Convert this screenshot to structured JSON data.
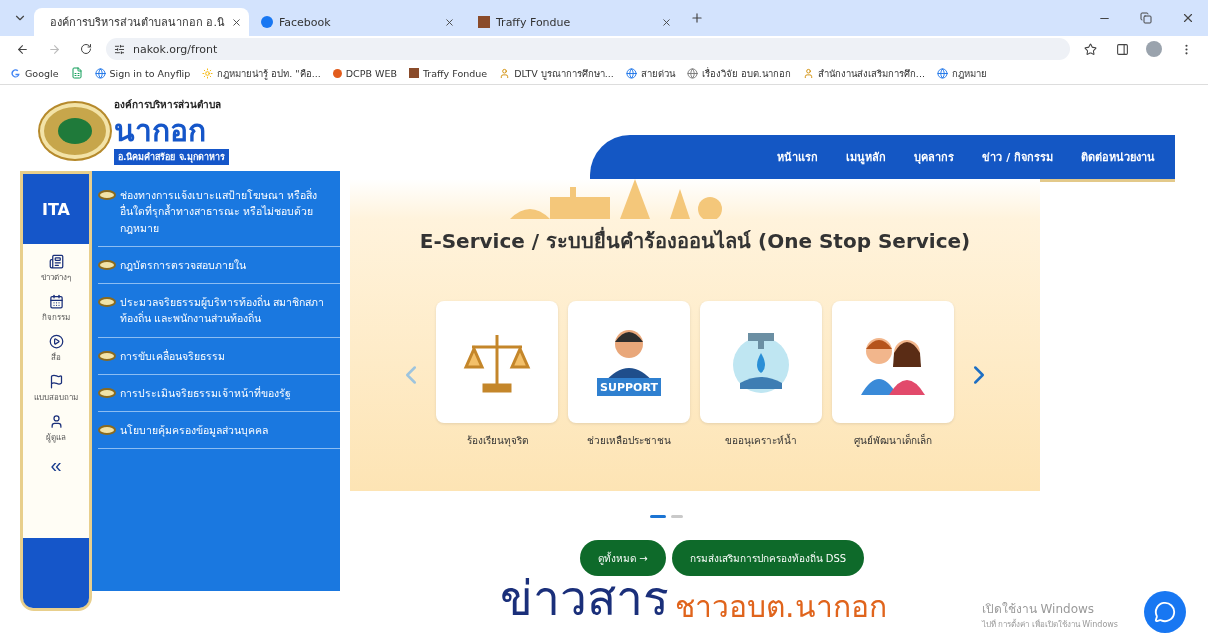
{
  "browser": {
    "tabs": [
      {
        "title": "องค์การบริหารส่วนตำบลนากอก อ.นิ",
        "selected": true,
        "kind": "site"
      },
      {
        "title": "Facebook",
        "selected": false,
        "kind": "facebook"
      },
      {
        "title": "Traffy Fondue",
        "selected": false,
        "kind": "traffy"
      }
    ],
    "url": "nakok.org/front",
    "bookmarks": [
      {
        "label": "Google",
        "kind": "google"
      },
      {
        "kind": "sheet"
      },
      {
        "label": "Sign in to Anyflip",
        "kind": "circle"
      },
      {
        "label": "กฎหมายน่ารู้ อปท. \"คือ...",
        "kind": "sun"
      },
      {
        "label": "DCPB WEB",
        "kind": "dot"
      },
      {
        "label": "Traffy Fondue",
        "kind": "traffy"
      },
      {
        "label": "DLTV บูรณาการศึกษา...",
        "kind": "person"
      },
      {
        "label": "สายด่วน",
        "kind": "circle"
      },
      {
        "label": "เรื่องวิจัย อบต.นากอก",
        "kind": "globe"
      },
      {
        "label": "สำนักงานส่งเสริมการศึก...",
        "kind": "person"
      },
      {
        "label": "กฎหมาย",
        "kind": "circle"
      }
    ]
  },
  "site": {
    "org_name": "องค์การบริหารส่วนตำบล",
    "name": "นากอก",
    "district": "อ.นิคมคำสร้อย จ.มุกดาหาร",
    "nav": [
      "หน้าแรก",
      "เมนูหลัก",
      "บุคลากร",
      "ข่าว / กิจกรรม",
      "ติดต่อหน่วยงาน"
    ],
    "ita": {
      "logo": "ITA",
      "items": [
        {
          "label": "ข่าวต่างๆ",
          "kind": "news"
        },
        {
          "label": "กิจกรรม",
          "kind": "calendar"
        },
        {
          "label": "สื่อ",
          "kind": "play"
        },
        {
          "label": "แบบสอบถาม",
          "kind": "flag"
        },
        {
          "label": "ผู้ดูแล",
          "kind": "user"
        }
      ],
      "collapse": "«"
    },
    "menu": [
      "ช่องทางการแจ้งเบาะแสป้ายโฆษณา หรือสิ่งอื่นใดที่รุกล้ำทางสาธารณะ หรือไม่ชอบด้วยกฎหมาย",
      "กฎบัตรการตรวจสอบภายใน",
      "ประมวลจริยธรรมผู้บริหารท้องถิ่น สมาชิกสภาท้องถิ่น และพนักงานส่วนท้องถิ่น",
      "การขับเคลื่อนจริยธรรม",
      "การประเมินจริยธรรมเจ้าหน้าที่ของรัฐ",
      "นโยบายคุ้มครองข้อมูลส่วนบุคคล"
    ],
    "eservice": {
      "title": "E-Service / ระบบยื่นคำร้องออนไลน์ (One Stop Service)",
      "cards": [
        {
          "label": "ร้องเรียนทุจริต",
          "kind": "scale"
        },
        {
          "label": "ช่วยเหลือประชาชน",
          "kind": "support",
          "badge": "SUPPORT"
        },
        {
          "label": "ขออนุเคราะห์น้ำ",
          "kind": "water"
        },
        {
          "label": "ศูนย์พัฒนาเด็กเล็ก",
          "kind": "kids"
        }
      ],
      "dots": [
        {
          "selected": true
        },
        {
          "selected": false
        }
      ]
    },
    "buttons": [
      "ดูทั้งหมด →",
      "กรมส่งเสริมการปกครองท้องถิ่น DSS"
    ],
    "heading": {
      "main": "ข่าวสาร",
      "sub": "ชาวอบต.นากอก"
    }
  },
  "windows_notice": {
    "title": "เปิดใช้งาน Windows",
    "text": "ไปที่ การตั้งค่า เพื่อเปิดใช้งาน Windows"
  }
}
